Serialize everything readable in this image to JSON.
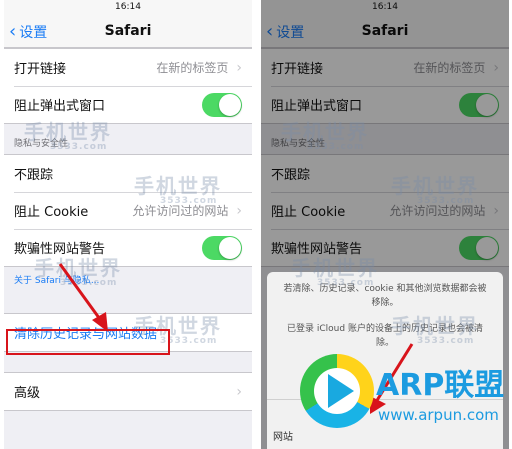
{
  "left": {
    "status_time": "16:14",
    "nav": {
      "back": "设置",
      "title": "Safari"
    },
    "rows_top": [
      {
        "label": "打开链接",
        "value": "在新的标签页"
      },
      {
        "label": "阻止弹出式窗口",
        "toggle": true
      }
    ],
    "privacy_header": "隐私与安全性",
    "rows_privacy": [
      {
        "label": "不跟踪"
      },
      {
        "label": "阻止 Cookie",
        "value": "允许访问过的网站"
      },
      {
        "label": "欺骗性网站警告",
        "toggle": true
      }
    ],
    "privacy_link": "关于 Safari 与隐私...",
    "clear_label": "清除历史记录与网站数据",
    "advanced_label": "高级"
  },
  "right": {
    "status_time": "16:14",
    "nav": {
      "back": "设置",
      "title": "Safari"
    },
    "rows_top": [
      {
        "label": "打开链接",
        "value": "在新的标签页"
      },
      {
        "label": "阻止弹出式窗口",
        "toggle": true
      }
    ],
    "privacy_header": "隐私与安全性",
    "rows_privacy": [
      {
        "label": "不跟踪"
      },
      {
        "label": "阻止 Cookie",
        "value": "允许访问过的网站"
      },
      {
        "label": "欺骗性网站警告",
        "toggle": true
      }
    ],
    "sheet_line1": "若清除、历史记录、cookie 和其他浏览数据都会被移除。",
    "sheet_line2": "已登录 iCloud 账户的设备上的历史记录也会被清除。",
    "sheet_peek": "网站"
  },
  "watermark": {
    "name": "手机世界",
    "domain": "3533.com"
  },
  "logo": {
    "name": "ARP联盟",
    "url": "www.arpun.com"
  },
  "colors": {
    "accent": "#1a7cf5",
    "toggle_on": "#4cd964",
    "annotation": "#d8141b"
  }
}
